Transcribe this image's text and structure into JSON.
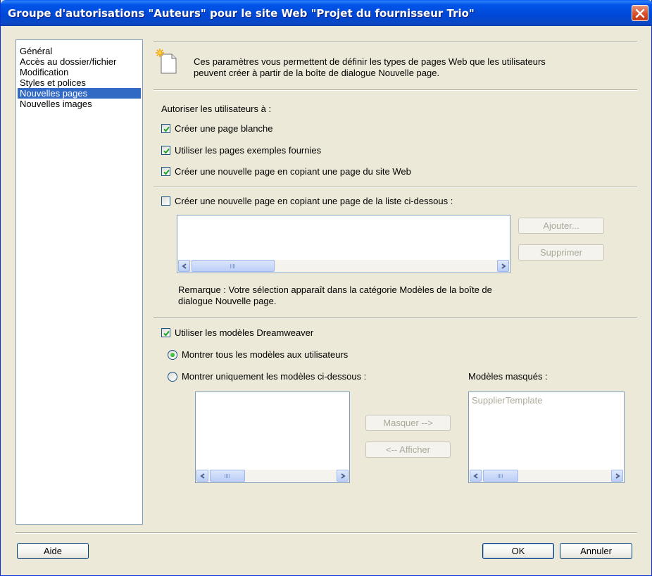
{
  "window": {
    "title": "Groupe d'autorisations \"Auteurs\" pour le site Web \"Projet du fournisseur Trio\"",
    "close_icon": "close-icon",
    "accent": "#0055ea"
  },
  "categories": [
    {
      "label": "Général"
    },
    {
      "label": "Accès au dossier/fichier"
    },
    {
      "label": "Modification"
    },
    {
      "label": "Styles et polices"
    },
    {
      "label": "Nouvelles pages",
      "selected": true
    },
    {
      "label": "Nouvelles images"
    }
  ],
  "header": {
    "icon": "new-page-icon",
    "description_line1": "Ces paramètres vous permettent de définir les types de pages Web que les utilisateurs",
    "description_line2": "peuvent créer à partir de la boîte de dialogue Nouvelle page."
  },
  "allow": {
    "label": "Autoriser les utilisateurs à :",
    "options": [
      {
        "label": "Créer une page blanche",
        "checked": true
      },
      {
        "label": "Utiliser les pages exemples fournies",
        "checked": true
      },
      {
        "label": "Créer une nouvelle page en copiant une page du site Web",
        "checked": true
      }
    ]
  },
  "copy_list": {
    "label": "Créer une nouvelle page en copiant une page de la liste ci-dessous :",
    "checked": false,
    "add_button": "Ajouter...",
    "remove_button": "Supprimer",
    "note_line1": "Remarque : Votre sélection apparaît dans la catégorie Modèles de la boîte de",
    "note_line2": "dialogue Nouvelle page."
  },
  "templates": {
    "use_label": "Utiliser les modèles Dreamweaver",
    "use_checked": true,
    "show_all_label": "Montrer tous les modèles aux utilisateurs",
    "show_only_label": "Montrer uniquement les modèles ci-dessous :",
    "selected_option": "show_all",
    "hidden_label": "Modèles masqués :",
    "hidden_items": [
      "SupplierTemplate"
    ],
    "hide_button": "Masquer -->",
    "show_button": "<-- Afficher"
  },
  "footer": {
    "help_button": "Aide",
    "ok_button": "OK",
    "cancel_button": "Annuler"
  }
}
